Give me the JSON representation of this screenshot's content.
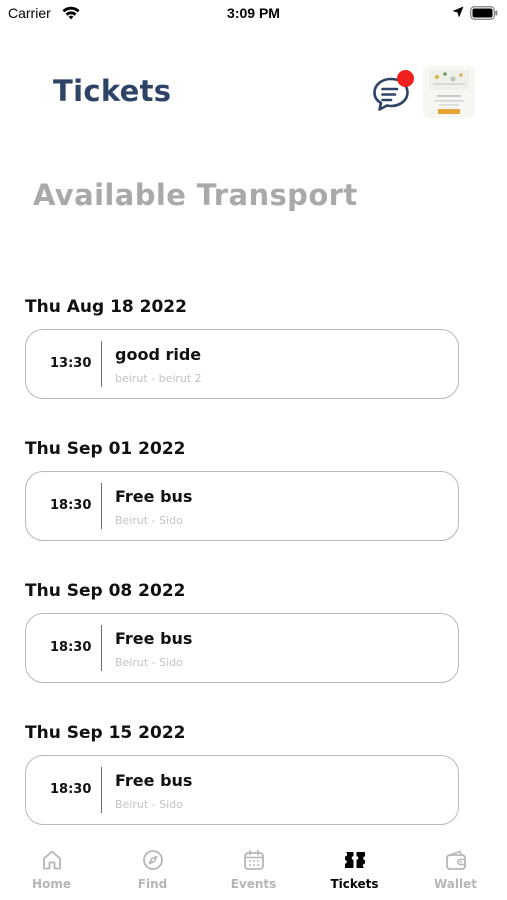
{
  "status_bar": {
    "carrier": "Carrier",
    "time": "3:09 PM"
  },
  "header": {
    "title": "Tickets",
    "chat_icon": "chat-bubble-icon",
    "has_notification": true
  },
  "section": {
    "heading": "Available Transport"
  },
  "groups": [
    {
      "date": "Thu Aug 18 2022",
      "ticket": {
        "time": "13:30",
        "name": "good ride",
        "route": "beirut - beirut 2"
      }
    },
    {
      "date": "Thu Sep 01 2022",
      "ticket": {
        "time": "18:30",
        "name": "Free bus",
        "route": "Beirut - Sido"
      }
    },
    {
      "date": "Thu Sep 08 2022",
      "ticket": {
        "time": "18:30",
        "name": "Free bus",
        "route": "Beirut - Sido"
      }
    },
    {
      "date": "Thu Sep 15 2022",
      "ticket": {
        "time": "18:30",
        "name": "Free bus",
        "route": "Beirut - Sido"
      }
    }
  ],
  "tabs": [
    {
      "label": "Home",
      "icon": "home-icon",
      "active": false
    },
    {
      "label": "Find",
      "icon": "compass-icon",
      "active": false
    },
    {
      "label": "Events",
      "icon": "calendar-icon",
      "active": false
    },
    {
      "label": "Tickets",
      "icon": "tickets-icon",
      "active": true
    },
    {
      "label": "Wallet",
      "icon": "wallet-icon",
      "active": false
    }
  ],
  "colors": {
    "title": "#2e4467",
    "heading": "#a9a9a9",
    "notification": "#f0201e",
    "tab_inactive": "#b6b6b6",
    "tab_active": "#000000"
  }
}
